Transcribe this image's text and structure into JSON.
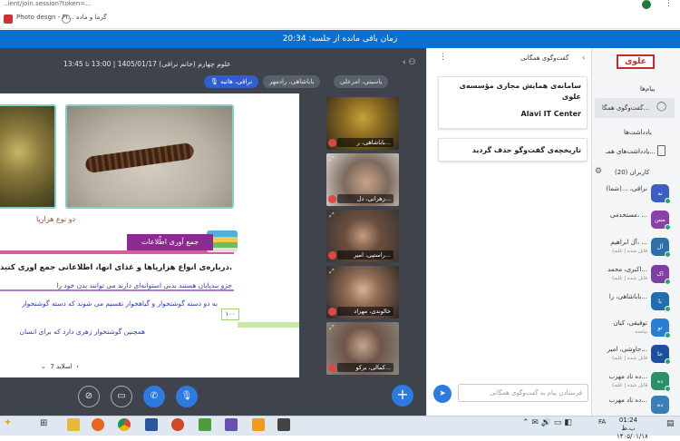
{
  "browser": {
    "url_fragment": "..ient/join.session?token=...",
    "bookmarks": [
      "Photo desgn - Pr...",
      "گرما و ماده"
    ]
  },
  "banner": {
    "text": "زمان باقی مانده از جلسه: 20:34"
  },
  "session": {
    "title": "علوم چهارم (خانم نراقی) 1405/01/17 | 13:00 تا 13:45",
    "chips": [
      "نراقی، هانیه",
      "باباشاهی، رادمهر",
      "یاسینی، امرعلی"
    ]
  },
  "slide": {
    "caption": "دو نوع هزارپا",
    "section_header": "جمع آوری اطّلاعات",
    "para1": "درباره‌ی انواع هزارپاها و غذای آنها، اطّلاعاتی جمع آوری کنید.",
    "para2": "جزو بندپایان هستند بدنی استوانه‌ای دارند می توانند بدن خود را",
    "para3": "به دو دسته گوشتخوار و گیاهخوار تقسیم می شوند که دسته گوشتخوار",
    "para4": "همچنین گوشتخوار زهری دارد که برای انسان",
    "box_number": "۱۰۰",
    "pager": "اسلاید 7"
  },
  "videos": [
    {
      "label": "باباشاهی، ر..."
    },
    {
      "label": "زهرانی، دل..."
    },
    {
      "label": "راستپی، امیر..."
    },
    {
      "label": "خالوندی، مهراد"
    },
    {
      "label": "کمالی، برکو..."
    }
  ],
  "controls": [
    "screen-share-icon",
    "camera-off-icon",
    "phone-icon",
    "mic-icon"
  ],
  "chat": {
    "title": "گفت‌وگوی همگانی",
    "card1_title": "سامانه‌ی همایش مجازی مؤسسه‌ی علوی",
    "card1_sub": "Alavi IT Center",
    "card2_text": "تاریخچه‌ی گفت‌وگو حذف گردید",
    "input_placeholder": "فرستادن پیام به گفت‌وگوی همگانی"
  },
  "sidebar": {
    "logo": "علوی",
    "messages_heading": "پیام‌ها",
    "public_chat": "گفت‌وگوی همگا...",
    "notes_heading": "یادداشت‌ها",
    "shared_notes": "یادداشت‌های همـ...",
    "users_heading": "کاربران (20)",
    "users": [
      {
        "name": "نراقی، ...(شما)",
        "role": "",
        "initials": "نه",
        "color": "#3b5fc7"
      },
      {
        "name": "مستخدمی، ...",
        "role": "",
        "initials": "مس",
        "color": "#8b3fa8"
      },
      {
        "name": "آل ابراهیم، ...",
        "role": "(قابل شده | غلبه",
        "initials": "آل",
        "color": "#2f6fa8"
      },
      {
        "name": "اکبری، محمد...",
        "role": "(قابل شده | غلبه",
        "initials": "اک",
        "color": "#7d3fa0"
      },
      {
        "name": "باباشاهی، را...",
        "role": "",
        "initials": "با",
        "color": "#1f6fb0"
      },
      {
        "name": "توفیقی، کیان",
        "role": "نیامده",
        "initials": "تو",
        "color": "#2a7fd4"
      },
      {
        "name": "جاوشی، امیر...",
        "role": "(قابل شده | غلبه",
        "initials": "جا",
        "color": "#1d4fa0"
      },
      {
        "name": "ده ناد مهرب...",
        "role": "(قابل شده | غلبه",
        "initials": "ده",
        "color": "#2b8f6a"
      },
      {
        "name": "ده ناد مهرب...",
        "role": "",
        "initials": "ده",
        "color": "#3a7fb8"
      }
    ]
  },
  "taskbar": {
    "time": "01:24 ب.ظ",
    "date": "۱۴۰۵/۰۱/۱۸",
    "lang": "FA"
  }
}
